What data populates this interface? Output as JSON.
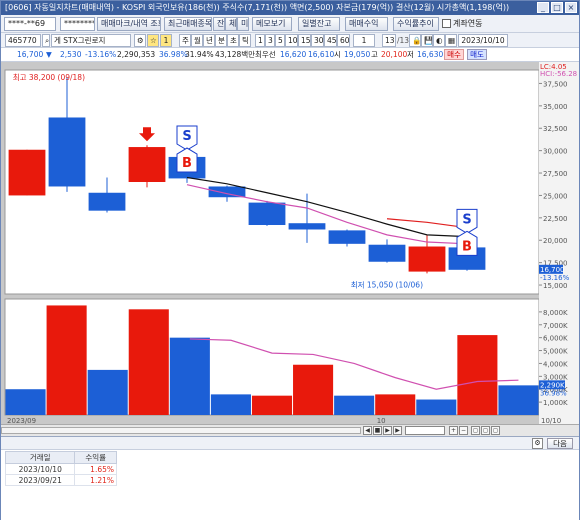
{
  "window": {
    "title": "[0606] 자동일지차트(매매내역) - KOSPI  외국인보유(186(천))  주식수(7,171(천))  액면(2,500)  자본금(179(억))  결산(12월)  시가총액(1,198(억))",
    "buttons": [
      "_",
      "□",
      "×",
      "▣"
    ]
  },
  "toolbar1": {
    "account": "****-**69",
    "password": "********",
    "trade_mark_button": "매매마크/내역 조회",
    "recent_stocks_button": "최근매매종목",
    "jan": "잔",
    "che": "체",
    "mi": "미",
    "memo_button": "메모보기",
    "daily_balance_button": "일별잔고",
    "trade_profit_button": "매매수익",
    "return_trend_button": "수익률추이",
    "account_link_label": "계좌연동"
  },
  "toolbar2": {
    "code": "465770",
    "name": "게 STX그린로지",
    "period_num": "1",
    "periods": [
      "주",
      "월",
      "년",
      "분",
      "초",
      "틱"
    ],
    "intervals": [
      "1",
      "3",
      "5",
      "10",
      "15",
      "30",
      "45",
      "60"
    ],
    "count_value": "1",
    "page": "13",
    "page_total": "13",
    "date": "2023/10/10"
  },
  "infobar": {
    "price": "16,700",
    "change": "2,530",
    "change_pct": "-13.16%",
    "volume": "2,290,353",
    "ratio1": "36.98%",
    "ratio2": "31.94%",
    "amount": "43,128백만",
    "best_ask_label": "최우선",
    "best_ask": "16,620",
    "best_bid": "16,610",
    "open_label": "시",
    "open": "19,050",
    "high_label": "고",
    "high": "20,100",
    "low_label": "저",
    "low": "16,630",
    "buy_label": "매수",
    "sell_label": "매도"
  },
  "colors": {
    "up": "#e8190c",
    "down": "#1c5fd6",
    "ma_black": "#111111",
    "ma_red": "#e02020",
    "ma_pink": "#d050b0",
    "marker_blue": "#1a3ecc"
  },
  "chart_data": [
    {
      "type": "candlestick",
      "title": "",
      "corner_labels": [
        "LC:4.05",
        "HCI:-56.28"
      ],
      "y_ticks": [
        "37,500",
        "35,000",
        "32,500",
        "30,000",
        "27,500",
        "25,000",
        "22,500",
        "20,000",
        "17,500",
        "15,000"
      ],
      "ylim": [
        14000,
        39000
      ],
      "candles": [
        {
          "open": 25000,
          "close": 30100,
          "high": 30100,
          "low": 25000
        },
        {
          "open": 33700,
          "close": 26000,
          "high": 38200,
          "low": 25400
        },
        {
          "open": 25300,
          "close": 23300,
          "high": 27000,
          "low": 23100
        },
        {
          "open": 26500,
          "close": 30400,
          "high": 30600,
          "low": 25900
        },
        {
          "open": 29300,
          "close": 26900,
          "high": 29400,
          "low": 26400
        },
        {
          "open": 26000,
          "close": 24800,
          "high": 26100,
          "low": 24300
        },
        {
          "open": 24200,
          "close": 21700,
          "high": 24400,
          "low": 21600
        },
        {
          "open": 21900,
          "close": 21200,
          "high": 25200,
          "low": 19700
        },
        {
          "open": 21100,
          "close": 19600,
          "high": 21200,
          "low": 19300
        },
        {
          "open": 19500,
          "close": 17600,
          "high": 20100,
          "low": 17500
        },
        {
          "open": 16500,
          "close": 19300,
          "high": 20600,
          "low": 16300
        },
        {
          "open": 19200,
          "close": 16700,
          "high": 20100,
          "low": 16600
        }
      ],
      "ma_black": [
        null,
        null,
        null,
        null,
        27000,
        26300,
        25300,
        24300,
        23100,
        21800,
        20600,
        20400
      ],
      "ma_red": [
        null,
        null,
        null,
        null,
        null,
        null,
        null,
        null,
        null,
        22400,
        22000,
        21400
      ],
      "ma_pink": [
        null,
        null,
        null,
        null,
        26200,
        25200,
        24300,
        23600,
        22000,
        20600,
        19800,
        19600
      ],
      "max_label": "최고 38,200 (09/18)",
      "min_label": "최저 15,050 (10/06)",
      "last_price_label": "16,700",
      "last_pct_label": "-13.16%",
      "markers": [
        {
          "type": "arrow",
          "index": 3
        },
        {
          "type": "S",
          "index": 4
        },
        {
          "type": "B",
          "index": 4
        },
        {
          "type": "S",
          "index": 11
        },
        {
          "type": "B",
          "index": 11
        }
      ]
    },
    {
      "type": "bar",
      "title": "",
      "y_ticks": [
        "8,000K",
        "7,000K",
        "6,000K",
        "5,000K",
        "4,000K",
        "3,000K",
        "2,000K",
        "1,000K"
      ],
      "ylim": [
        0,
        9000
      ],
      "values": [
        2000,
        8500,
        3500,
        8200,
        6000,
        1600,
        1500,
        3900,
        1500,
        1600,
        1200,
        6200,
        2300
      ],
      "up": [
        false,
        true,
        false,
        true,
        false,
        false,
        true,
        true,
        false,
        true,
        false,
        true,
        false
      ],
      "ma_pink": [
        null,
        null,
        null,
        null,
        5900,
        5800,
        4800,
        4700,
        4000,
        2900,
        2000,
        2600,
        2700
      ],
      "last_volume_label": "2,290K",
      "last_pct_label": "36.98%",
      "x_labels": [
        "2023/09",
        "10",
        "10/10"
      ]
    }
  ],
  "bottom_panel": {
    "next_button": "다음",
    "columns": [
      "거래일",
      "수익률"
    ],
    "rows": [
      [
        "2023/10/10",
        "1.65%"
      ],
      [
        "2023/09/21",
        "1.21%"
      ]
    ]
  }
}
